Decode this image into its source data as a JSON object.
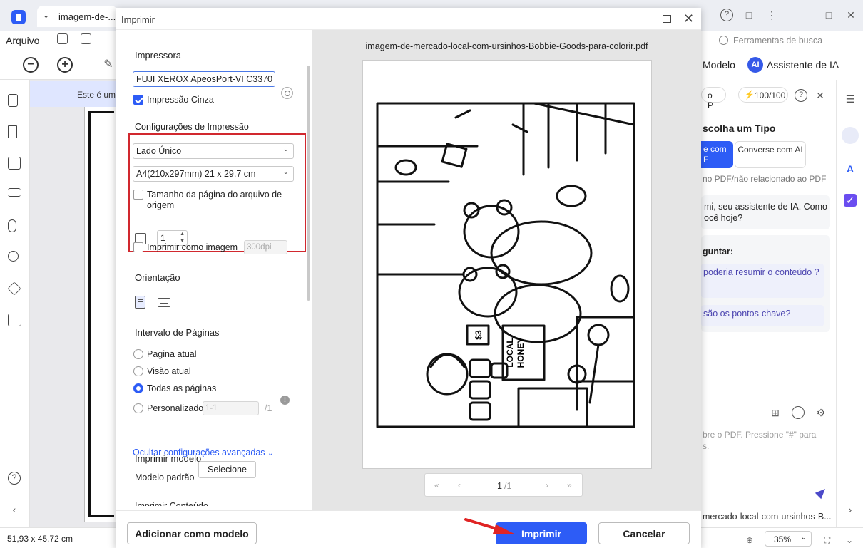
{
  "app": {
    "tab_title": "imagem-de-...c",
    "menu_arquivo": "Arquivo",
    "banner_text": "Este é um",
    "status_dimensions": "51,93 x 45,72 cm",
    "zoom_value": "35%",
    "icons": [
      "logo-icon",
      "tab-chevron-icon",
      "help-icon",
      "message-icon",
      "more-icon",
      "minimize-icon",
      "maximize-icon",
      "close-icon",
      "save-icon",
      "printer-icon",
      "zoom-out-icon",
      "zoom-in-icon",
      "highlighter-icon",
      "page-icon",
      "bookmark-icon",
      "comment-icon",
      "layers-icon",
      "attachment-icon",
      "search-icon",
      "stack-icon",
      "signature-icon"
    ]
  },
  "ai_panel": {
    "search_placeholder": "Ferramentas de busca",
    "modelo": "Modelo",
    "ai_badge": "AI",
    "ai_title": "Assistente de IA",
    "model_pill": "o P",
    "credits": "100/100",
    "heading": "scolha um Tipo",
    "tab_active": "e com\nF",
    "tab_other": "Converse com AI",
    "note": "no PDF/não relacionado ao PDF",
    "greeting": "mi, seu assistente de IA. Como ocê hoje?",
    "ask_label": "guntar:",
    "question_1": "poderia resumir o conteúdo ?",
    "question_2": "são os pontos-chave?",
    "input_hint": "bre o PDF. Pressione \"#\" para s.",
    "file_name": "mercado-local-com-ursinhos-B..."
  },
  "dialog": {
    "title": "Imprimir",
    "printer_label": "Impressora",
    "printer_value": "FUJI XEROX ApeosPort-VI C3370",
    "grayscale_label": "Impressão Cinza",
    "grayscale_checked": true,
    "print_settings_label": "Configurações de Impressão",
    "sides_value": "Lado Único",
    "paper_value": "A4(210x297mm) 21 x 29,7 cm",
    "source_size_label": "Tamanho da página do arquivo de origem",
    "source_size_checked": false,
    "copies_value": "1",
    "print_as_image_label": "Imprimir como imagem",
    "dpi_value": "300dpi",
    "orientation_label": "Orientação",
    "range_label": "Intervalo de Páginas",
    "range_options": [
      "Pagina atual",
      "Visão atual",
      "Todas as páginas",
      "Personalizado"
    ],
    "range_selected": "Todas as páginas",
    "custom_range_placeholder": "1-1",
    "custom_range_total": "/1",
    "advanced_link": "Ocultar configurações avançadas",
    "template_label": "Imprimir modelo",
    "default_template_label": "Modelo padrão",
    "select_button": "Selecione",
    "content_label_cut": "Imprimir Conteúdo",
    "preview_filename": "imagem-de-mercado-local-com-ursinhos-Bobbie-Goods-para-colorir.pdf",
    "page_current": "1",
    "page_total": "/1",
    "add_template_button": "Adicionar como modelo",
    "print_button": "Imprimir",
    "cancel_button": "Cancelar"
  },
  "illustration": {
    "sign_text": [
      "LOCAL",
      "HONEY"
    ],
    "price_text": "$3"
  },
  "colors": {
    "accent": "#2d5cf6",
    "highlight_box": "#d1282e",
    "arrow": "#e02424"
  }
}
